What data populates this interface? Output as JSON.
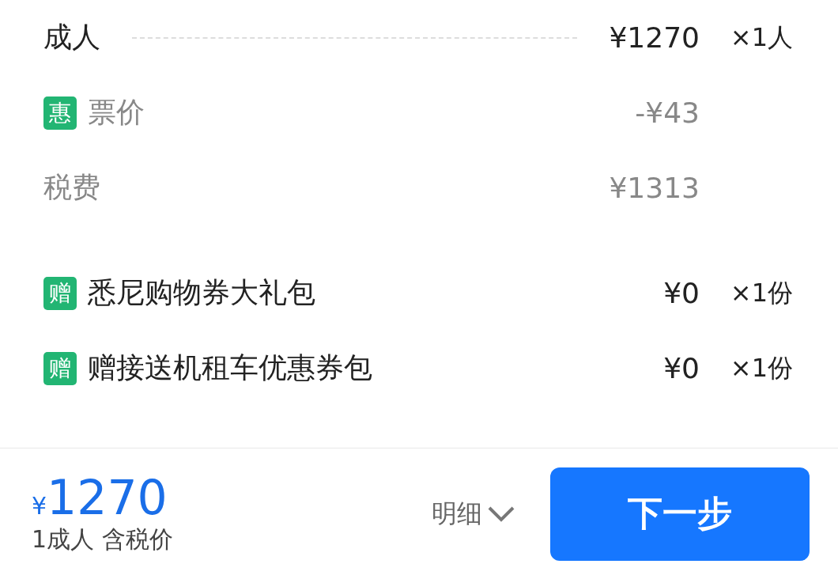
{
  "fare_lines": [
    {
      "kind": "passenger",
      "label": "成人",
      "price": "¥1270",
      "quantity": "×1人"
    },
    {
      "kind": "discount",
      "badge": "惠",
      "label": "票价",
      "price": "-¥43"
    },
    {
      "kind": "fee",
      "label": "税费",
      "price": "¥1313"
    }
  ],
  "gifts": [
    {
      "badge": "赠",
      "label": "悉尼购物券大礼包",
      "price": "¥0",
      "quantity": "×1份"
    },
    {
      "badge": "赠",
      "label": "赠接送机租车优惠券包",
      "price": "¥0",
      "quantity": "×1份"
    }
  ],
  "footer": {
    "currency": "¥",
    "total": "1270",
    "caption": "1成人 含税价",
    "details_label": "明细",
    "next_button": "下一步"
  }
}
